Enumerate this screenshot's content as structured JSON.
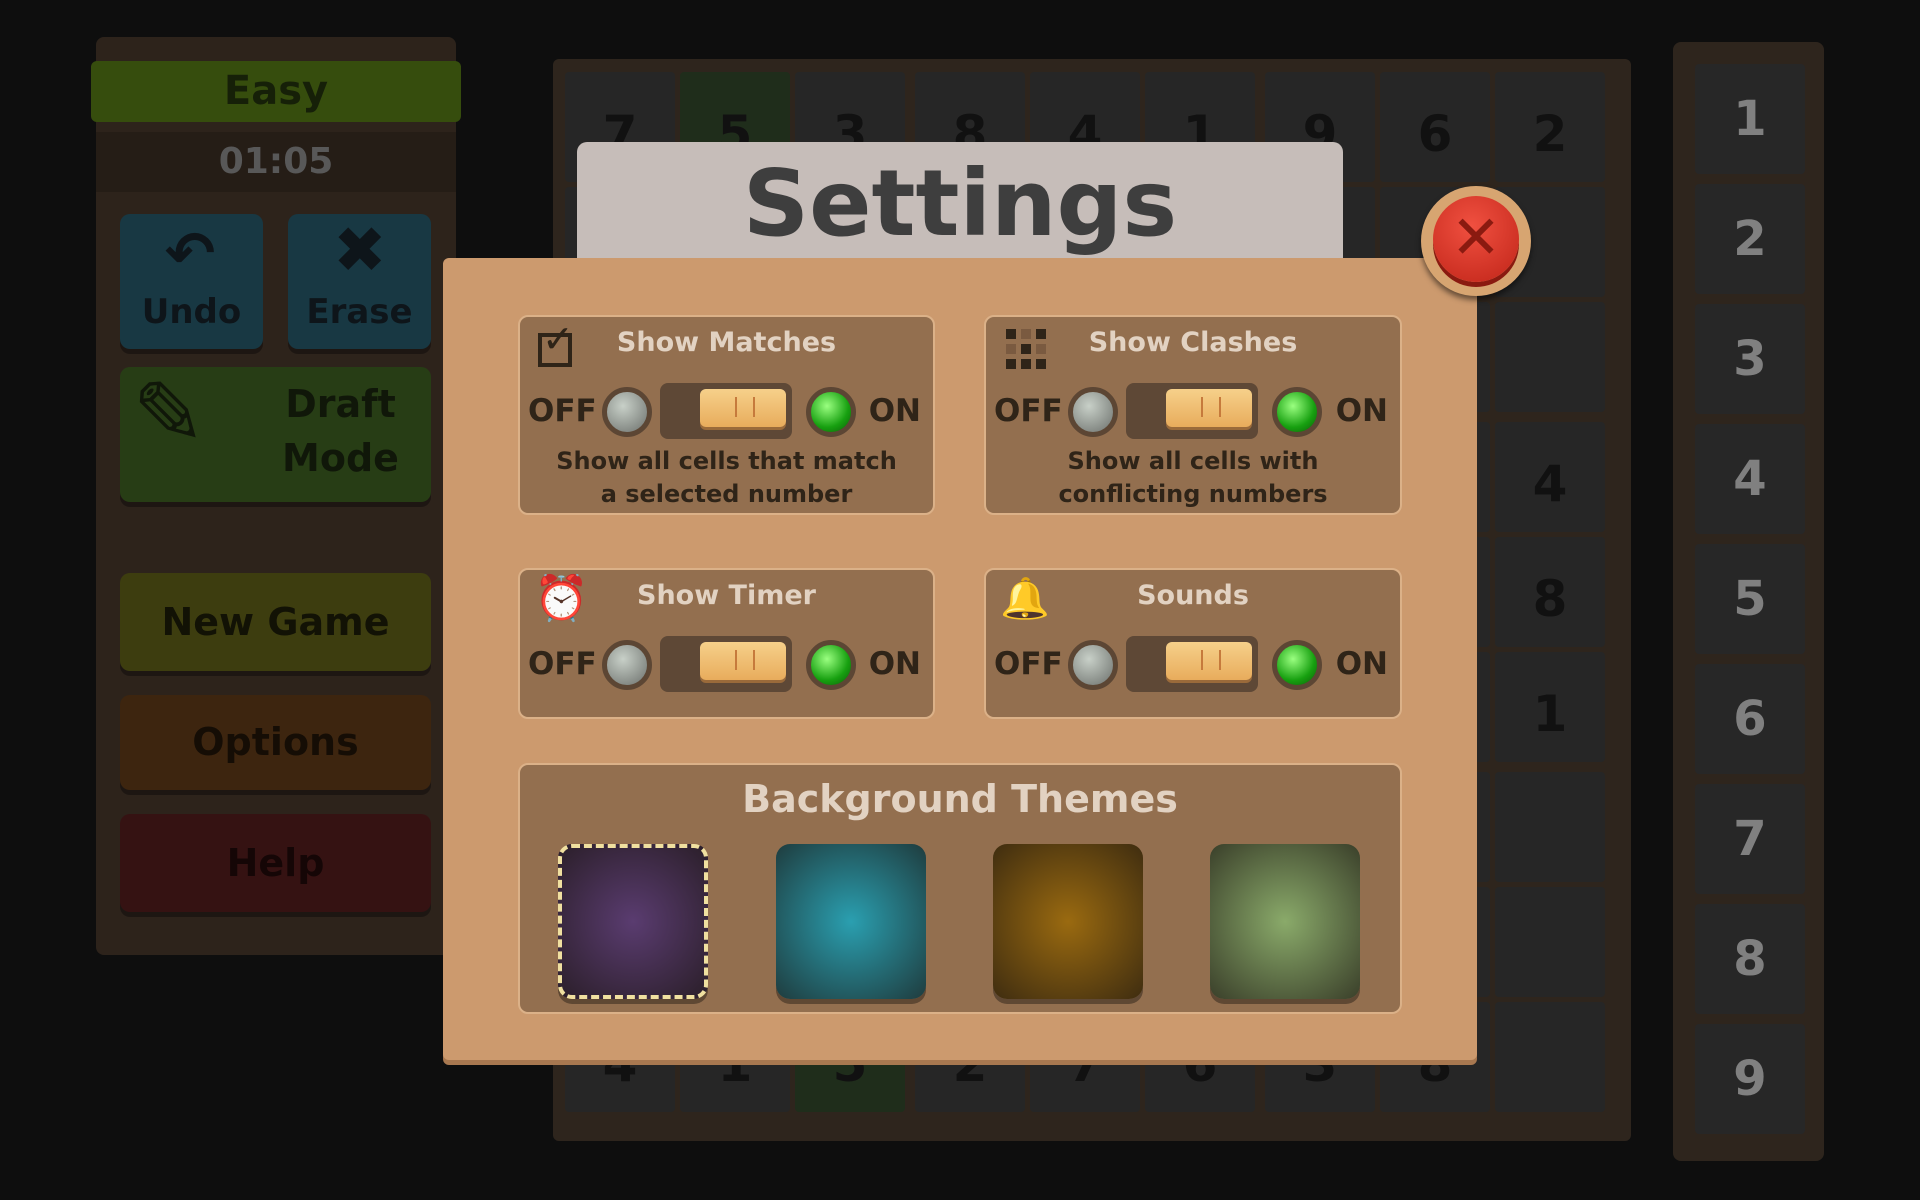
{
  "sidebar": {
    "difficulty": "Easy",
    "timer": "01:05",
    "undo": "Undo",
    "erase": "Erase",
    "draft": "Draft",
    "mode": "Mode",
    "new_game": "New Game",
    "options": "Options",
    "help": "Help"
  },
  "grid": {
    "top_row": [
      "7",
      "5",
      "3",
      "8",
      "4",
      "1",
      "9",
      "6",
      "2"
    ],
    "right_col_rows_4_6": [
      "4",
      "8",
      "1"
    ],
    "bottom_row": [
      "4",
      "1",
      "5",
      "2",
      "7",
      "6",
      "3",
      "8",
      ""
    ]
  },
  "number_pad": [
    "1",
    "2",
    "3",
    "4",
    "5",
    "6",
    "7",
    "8",
    "9"
  ],
  "settings": {
    "title": "Settings",
    "cards": [
      {
        "title": "Show Matches",
        "icon": "checkbox-icon",
        "off": "OFF",
        "on": "ON",
        "state": "on",
        "desc1": "Show all cells that match",
        "desc2": "a selected number"
      },
      {
        "title": "Show Clashes",
        "icon": "grid-dots-icon",
        "off": "OFF",
        "on": "ON",
        "state": "on",
        "desc1": "Show all cells with",
        "desc2": "conflicting numbers"
      },
      {
        "title": "Show Timer",
        "icon": "alarm-clock-icon",
        "off": "OFF",
        "on": "ON",
        "state": "on"
      },
      {
        "title": "Sounds",
        "icon": "bell-icon",
        "off": "OFF",
        "on": "ON",
        "state": "on"
      }
    ],
    "themes_title": "Background Themes",
    "themes": [
      {
        "name": "purple",
        "color": "#5a3c70",
        "selected": true
      },
      {
        "name": "teal",
        "color": "#2a9fb0"
      },
      {
        "name": "amber",
        "color": "#9a6a10"
      },
      {
        "name": "green",
        "color": "#8aaa6a"
      }
    ]
  }
}
